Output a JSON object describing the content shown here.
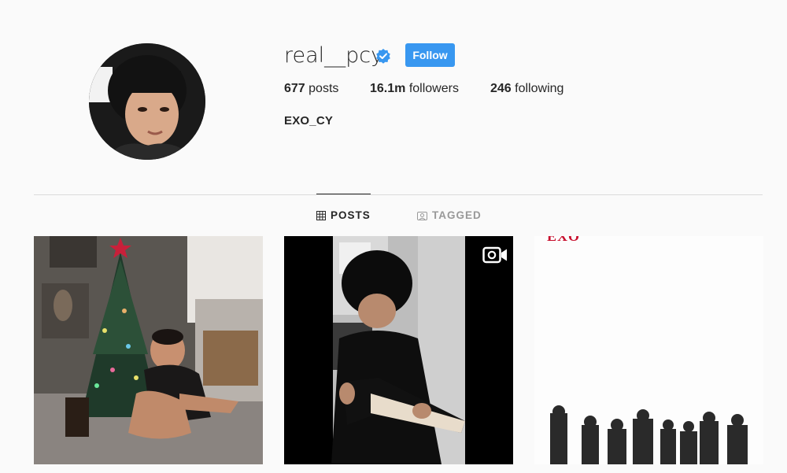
{
  "profile": {
    "username": "real__pcy",
    "verified": true,
    "follow_label": "Follow",
    "full_name": "EXO_CY",
    "stats": {
      "posts_count": "677",
      "posts_label": "posts",
      "followers_count": "16.1m",
      "followers_label": "followers",
      "following_count": "246",
      "following_label": "following"
    }
  },
  "tabs": [
    {
      "label": "POSTS",
      "icon": "grid-icon",
      "active": true
    },
    {
      "label": "TAGGED",
      "icon": "tag-icon",
      "active": false
    }
  ],
  "posts": [
    {
      "type": "photo",
      "icon": "photo"
    },
    {
      "type": "video",
      "icon": "video-camera-icon"
    },
    {
      "type": "photo",
      "caption_text": "EXO"
    }
  ],
  "colors": {
    "background": "#fafafa",
    "accent": "#3897f0",
    "text": "#262626",
    "muted": "#999999",
    "divider": "#dbdbdb",
    "exo_red": "#c8102e"
  }
}
